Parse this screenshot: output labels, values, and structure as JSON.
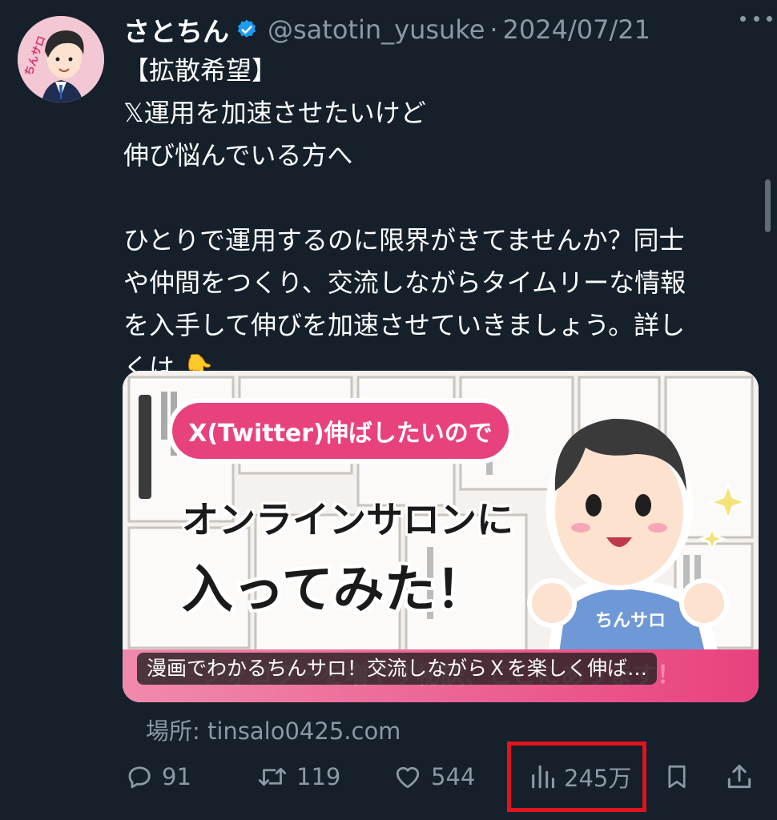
{
  "tweet": {
    "display_name": "さとちん",
    "handle": "@satotin_yusuke",
    "separator": "·",
    "date": "2024/07/21",
    "text_lines": [
      "【拡散希望】",
      "𝕏運用を加速させたいけど",
      "伸び悩んでいる方へ",
      "",
      "ひとりで運用するのに限界がきてませんか？同士",
      "や仲間をつくり、交流しながらタイムリーな情報",
      "を入手して伸びを加速させていきましょう。詳し",
      "くは"
    ],
    "emoji": "👇"
  },
  "avatar": {
    "label": "ちんサロ"
  },
  "card": {
    "bubble_text": "X(Twitter)伸ばしたいので",
    "headline_1": "オンラインサロンに",
    "headline_2": "入ってみた！",
    "shirt_text": "ちんサロ",
    "title": "漫画でわかるちんサロ！交流しながらＸを楽しく伸ば…",
    "band_text": "フォロワーを増やす秘訣、ここにあります！"
  },
  "location": "場所: tinsalo0425.com",
  "actions": {
    "reply": {
      "icon": "reply-icon",
      "count": "91"
    },
    "retweet": {
      "icon": "retweet-icon",
      "count": "119"
    },
    "like": {
      "icon": "heart-icon",
      "count": "544"
    },
    "views": {
      "icon": "views-chart-icon",
      "count": "245万"
    },
    "bookmark": {
      "icon": "bookmark-icon"
    },
    "share": {
      "icon": "share-icon"
    }
  },
  "colors": {
    "background": "#15202b",
    "muted_text": "#8b98a5",
    "verified": "#1d9bf0",
    "highlight_box": "#e0141e",
    "card_accent": "#e8427e"
  }
}
